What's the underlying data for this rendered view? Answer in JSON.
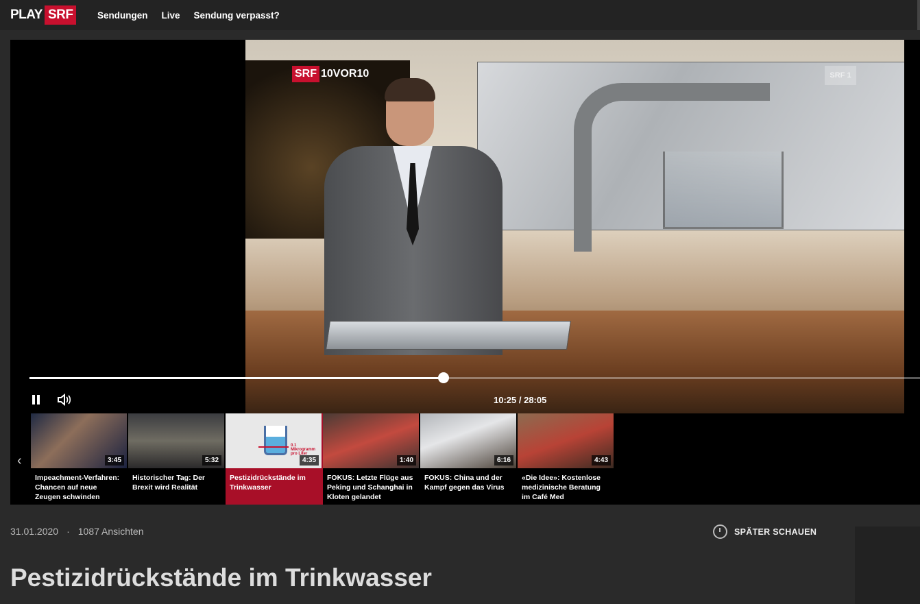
{
  "header": {
    "logo_play": "PLAY",
    "logo_srf": "SRF",
    "nav": [
      "Sendungen",
      "Live",
      "Sendung verpasst?"
    ]
  },
  "player": {
    "brand_srf": "SRF",
    "brand_show": "10VOR10",
    "channel_bug": "SRF 1",
    "timecode": "10:25 / 28:05",
    "progress": 0.465,
    "state": "playing"
  },
  "playlist": {
    "items": [
      {
        "title": "Impeachment-Verfahren: Chancen auf neue Zeugen schwinden",
        "duration": "3:45"
      },
      {
        "title": "Historischer Tag: Der Brexit wird Realität",
        "duration": "5:32"
      },
      {
        "title": "Pestizidrückstände im Trinkwasser",
        "duration": "4:35",
        "active": true
      },
      {
        "title": "FOKUS: Letzte Flüge aus Peking und Schanghai in Kloten gelandet",
        "duration": "1:40"
      },
      {
        "title": "FOKUS: China und der Kampf gegen das Virus",
        "duration": "6:16"
      },
      {
        "title": "«Die Idee»: Kostenlose medizinische Beratung im Café Med",
        "duration": "4:43"
      }
    ],
    "thumb3_text": "0.1 Mikrogramm pro Liter"
  },
  "meta": {
    "date": "31.01.2020",
    "separator": "·",
    "views": "1087 Ansichten",
    "watch_later": "SPÄTER SCHAUEN"
  },
  "title": "Pestizidrückstände im Trinkwasser",
  "colors": {
    "brand_red": "#c8102e",
    "active_item": "#a80f28",
    "background": "#2a2a2a"
  }
}
